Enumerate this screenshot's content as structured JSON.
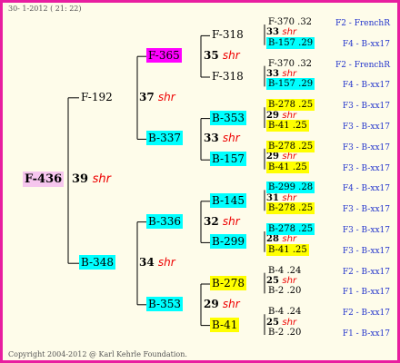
{
  "header": "30- 1-2012 ( 21: 22)",
  "footer": "Copyright 2004-2012 @ Karl Kehrle Foundation.",
  "pedigree": {
    "root": "F-436",
    "pair_root": {
      "num": "39",
      "shr": "shr"
    },
    "g1": [
      "F-192",
      "B-348"
    ],
    "pair_g1": [
      {
        "num": "37",
        "shr": "shr"
      },
      {
        "num": "34",
        "shr": "shr"
      }
    ],
    "g2": [
      "F-365",
      "B-337",
      "B-336",
      "B-353"
    ],
    "pair_g2": [
      {
        "num": "35",
        "shr": "shr"
      },
      {
        "num": "33",
        "shr": "shr"
      },
      {
        "num": "32",
        "shr": "shr"
      },
      {
        "num": "29",
        "shr": "shr"
      }
    ],
    "g3": [
      "F-318",
      "F-318",
      "B-353",
      "B-157",
      "B-145",
      "B-299",
      "B-278",
      "B-41"
    ],
    "pair_g3": [
      {
        "num": "33",
        "shr": "shr"
      },
      {
        "num": "33",
        "shr": "shr"
      },
      {
        "num": "29",
        "shr": "shr"
      },
      {
        "num": "29",
        "shr": "shr"
      },
      {
        "num": "31",
        "shr": "shr"
      },
      {
        "num": "28",
        "shr": "shr"
      },
      {
        "num": "25",
        "shr": "shr"
      },
      {
        "num": "25",
        "shr": "shr"
      }
    ],
    "g4": [
      "F-370 .32",
      "B-157 .29",
      "F-370 .32",
      "B-157 .29",
      "B-278 .25",
      "B-41 .25",
      "B-278 .25",
      "B-41 .25",
      "B-299 .28",
      "B-278 .25",
      "B-278 .25",
      "B-41 .25",
      "B-4 .24",
      "B-2 .20",
      "B-4 .24",
      "B-2 .20"
    ],
    "labels": [
      "F2 - FrenchR",
      "F4 - B-xx17",
      "F2 - FrenchR",
      "F4 - B-xx17",
      "F3 - B-xx17",
      "F3 - B-xx17",
      "F3 - B-xx17",
      "F3 - B-xx17",
      "F4 - B-xx17",
      "F3 - B-xx17",
      "F3 - B-xx17",
      "F3 - B-xx17",
      "F2 - B-xx17",
      "F1 - B-xx17",
      "F2 - B-xx17",
      "F1 - B-xx17"
    ]
  },
  "colors": {
    "border": "#e81ea0",
    "background": "#fefcea",
    "line": "#000000",
    "cyan": "#00ffff",
    "yellow": "#ffff00",
    "magenta": "#ff00ff",
    "pink": "#f6c6ee",
    "shr": "#ee0000",
    "label": "#2233cc"
  },
  "node_colors": {
    "root": "pink",
    "g1": [
      "none",
      "cyan"
    ],
    "g2": [
      "magenta",
      "cyan",
      "cyan",
      "cyan"
    ],
    "g3": [
      "none",
      "none",
      "cyan",
      "cyan",
      "cyan",
      "cyan",
      "yellow",
      "yellow"
    ],
    "g4": [
      "none",
      "cyan",
      "none",
      "cyan",
      "yellow",
      "yellow",
      "yellow",
      "yellow",
      "cyan",
      "yellow",
      "cyan",
      "yellow",
      "none",
      "none",
      "none",
      "none"
    ]
  }
}
